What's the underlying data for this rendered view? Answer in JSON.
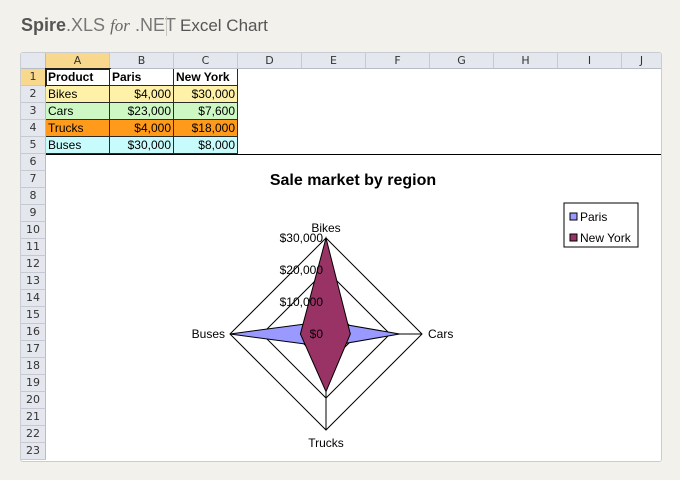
{
  "header": {
    "brand_bold": "Spire",
    "brand_dot": ".XLS",
    "brand_for": "for",
    "brand_net": ".NET",
    "title": "Excel Chart"
  },
  "sheet": {
    "columns": [
      "A",
      "B",
      "C",
      "D",
      "E",
      "F",
      "G",
      "H",
      "I",
      "J"
    ],
    "rows": [
      "1",
      "2",
      "3",
      "4",
      "5",
      "6",
      "7",
      "8",
      "9",
      "10",
      "11",
      "12",
      "13",
      "14",
      "15",
      "16",
      "17",
      "18",
      "19",
      "20",
      "21",
      "22",
      "23"
    ],
    "table": [
      [
        "Product",
        "Paris",
        "New York"
      ],
      [
        "Bikes",
        "$4,000",
        "$30,000"
      ],
      [
        "Cars",
        "$23,000",
        "$7,600"
      ],
      [
        "Trucks",
        "$4,000",
        "$18,000"
      ],
      [
        "Buses",
        "$30,000",
        "$8,000"
      ]
    ],
    "row_colors": [
      "#ffffff",
      "#fff2a8",
      "#cdf7c3",
      "#ff9a1a",
      "#c8fbfb"
    ]
  },
  "chart_data": {
    "type": "radar-filled",
    "title": "Sale market by region",
    "categories": [
      "Bikes",
      "Cars",
      "Trucks",
      "Buses"
    ],
    "series": [
      {
        "name": "Paris",
        "values": [
          4000,
          23000,
          4000,
          30000
        ],
        "color": "#9999ff"
      },
      {
        "name": "New York",
        "values": [
          30000,
          7600,
          18000,
          8000
        ],
        "color": "#993366"
      }
    ],
    "axis_ticks": [
      "$0",
      "$10,000",
      "$20,000",
      "$30,000"
    ],
    "ylim": [
      0,
      30000
    ],
    "legend_position": "top-right"
  }
}
